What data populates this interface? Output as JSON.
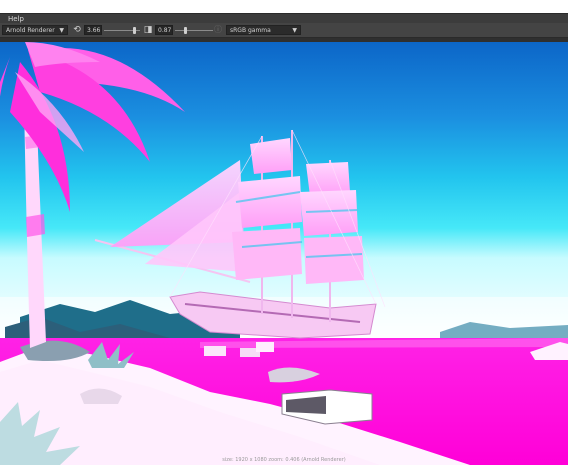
{
  "menu": {
    "help": "Help"
  },
  "toolbar": {
    "renderer": "Arnold Renderer",
    "exposure_value": "3.66",
    "gamma_value": "0.87",
    "color_space": "sRGB gamma"
  },
  "icons": {
    "refresh": "refresh-icon",
    "exposure": "exposure-icon",
    "info": "info-icon"
  },
  "status": {
    "text": "size: 1920 x 1080 zoom: 0.406    (Arnold Renderer)"
  }
}
